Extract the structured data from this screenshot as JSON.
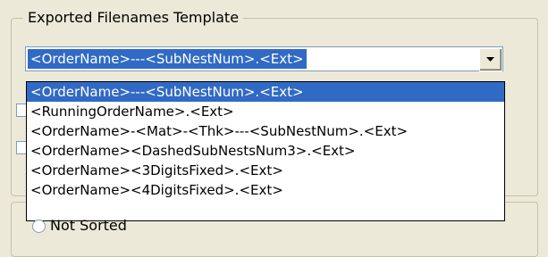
{
  "group": {
    "title": "Exported Filenames Template"
  },
  "combo": {
    "value": "<OrderName>---<SubNestNum>.<Ext>"
  },
  "dropdown": {
    "options": [
      "<OrderName>---<SubNestNum>.<Ext>",
      "<RunningOrderName>.<Ext>",
      "<OrderName>-<Mat>-<Thk>---<SubNestNum>.<Ext>",
      "<OrderName><DashedSubNestsNum3>.<Ext>",
      "<OrderName><3DigitsFixed>.<Ext>",
      "<OrderName><4DigitsFixed>.<Ext>"
    ],
    "selected_index": 0
  },
  "sort": {
    "radio_label": "Not Sorted"
  }
}
